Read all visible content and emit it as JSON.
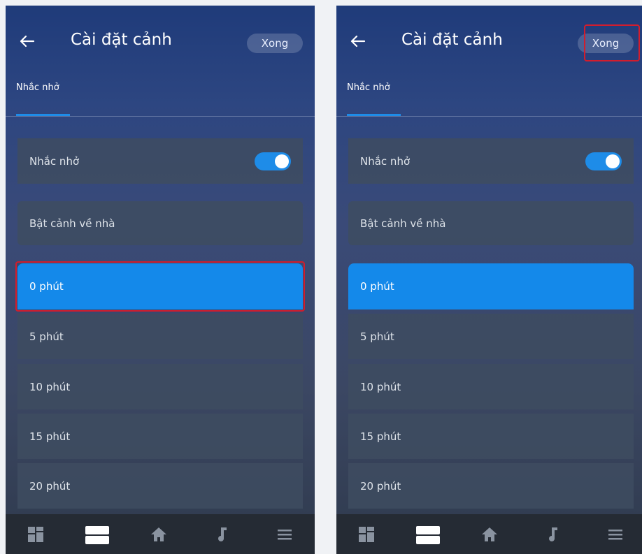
{
  "screens": [
    {
      "header": {
        "title": "Cài đặt cảnh",
        "done_label": "Xong"
      },
      "tab": {
        "label": "Nhắc nhở"
      },
      "reminder": {
        "label": "Nhắc nhở",
        "enabled": true
      },
      "trigger": {
        "label": "Bật cảnh về nhà"
      },
      "options": [
        "0 phút",
        "5 phút",
        "10 phút",
        "15 phút",
        "20 phút"
      ],
      "selected_option": "0 phút",
      "highlight": "selected-option"
    },
    {
      "header": {
        "title": "Cài đặt cảnh",
        "done_label": "Xong"
      },
      "tab": {
        "label": "Nhắc nhở"
      },
      "reminder": {
        "label": "Nhắc nhở",
        "enabled": true
      },
      "trigger": {
        "label": "Bật cảnh về nhà"
      },
      "options": [
        "0 phút",
        "5 phút",
        "10 phút",
        "15 phút",
        "20 phút"
      ],
      "selected_option": "0 phút",
      "highlight": "done-button"
    }
  ],
  "bottom_nav": {
    "items": [
      "dashboard-icon",
      "scenes-icon",
      "home-icon",
      "music-icon",
      "menu-icon"
    ],
    "active": "scenes-icon"
  },
  "colors": {
    "accent": "#1489ea",
    "highlight": "#d11d2d",
    "card": "#3e4c60"
  }
}
